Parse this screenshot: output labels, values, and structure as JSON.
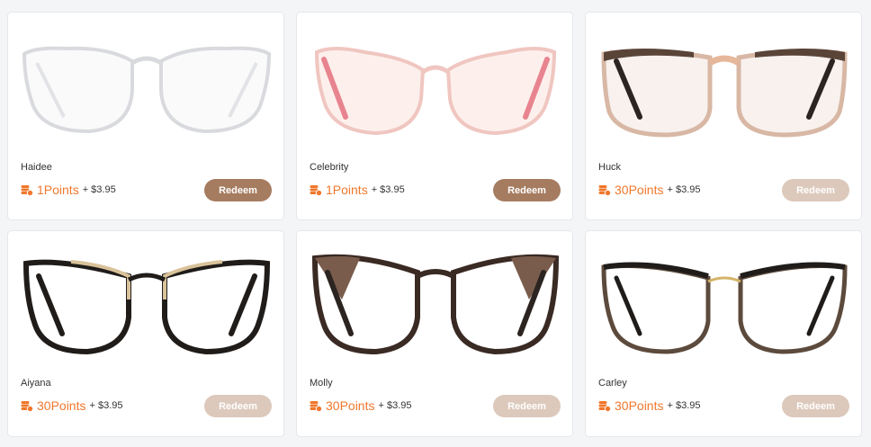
{
  "colors": {
    "points": "#f0782d",
    "redeem_active": "#a67c60",
    "redeem_disabled": "#dcc9bc"
  },
  "products": [
    {
      "name": "Haidee",
      "points": "1Points",
      "price": "+ $3.95",
      "button": "Redeem",
      "enabled": true,
      "image": "clear-cat-eye-glasses"
    },
    {
      "name": "Celebrity",
      "points": "1Points",
      "price": "+ $3.95",
      "button": "Redeem",
      "enabled": true,
      "image": "pink-cat-eye-glasses"
    },
    {
      "name": "Huck",
      "points": "30Points",
      "price": "+ $3.95",
      "button": "Redeem",
      "enabled": false,
      "image": "tortoise-square-glasses"
    },
    {
      "name": "Aiyana",
      "points": "30Points",
      "price": "+ $3.95",
      "button": "Redeem",
      "enabled": false,
      "image": "black-gold-cat-eye-glasses"
    },
    {
      "name": "Molly",
      "points": "30Points",
      "price": "+ $3.95",
      "button": "Redeem",
      "enabled": false,
      "image": "tortoise-black-cat-eye-glasses"
    },
    {
      "name": "Carley",
      "points": "30Points",
      "price": "+ $3.95",
      "button": "Redeem",
      "enabled": false,
      "image": "metal-browline-glasses"
    }
  ]
}
